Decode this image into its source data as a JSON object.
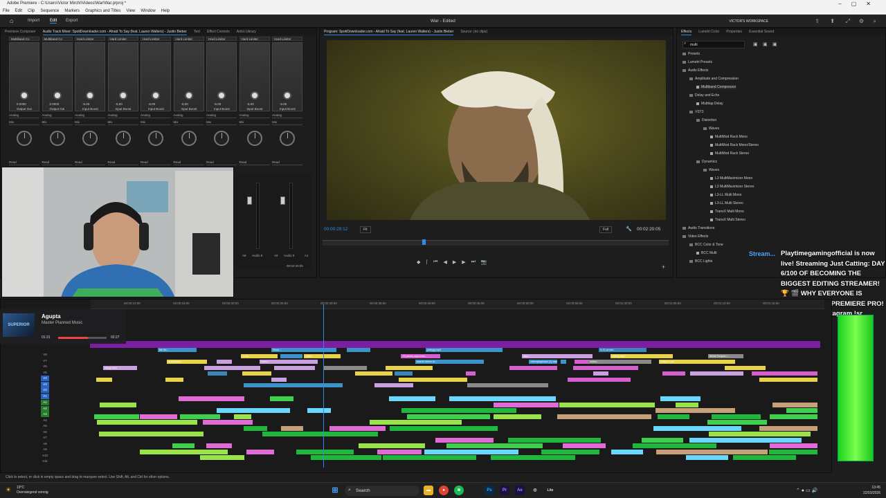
{
  "window": {
    "title": "Adobe Premiere - C:\\Users\\Victor Mirchi\\Videos\\War\\War.prproj *"
  },
  "menu": [
    "File",
    "Edit",
    "Clip",
    "Sequence",
    "Markers",
    "Graphics and Titles",
    "View",
    "Window",
    "Help"
  ],
  "header": {
    "tabs": [
      "Import",
      "Edit",
      "Export"
    ],
    "active_tab": "Edit",
    "doc_title": "War - Edited",
    "workspace": "VICTOR'S WORKSPACE"
  },
  "left_tabs": [
    "Premiere Composer",
    "Audio Track Mixer: SpotiDownloader.com - Afraid To Say (feat. Lauren Walters) - Justin Bieber",
    "Text",
    "Effect Controls",
    "Artist Library"
  ],
  "mixer": {
    "strips": [
      {
        "fx": "Multiband Co",
        "val": "0.0000",
        "sub": "Output Gai",
        "mode": "Mix"
      },
      {
        "fx": "Multiband Co",
        "val": "0.0000",
        "sub": "Output Gai",
        "mode": "Mix"
      },
      {
        "fx": "Hard Limiter",
        "val": "-6.00",
        "sub": "Input Boost",
        "mode": "Mix"
      },
      {
        "fx": "Hard Limiter",
        "val": "-6.00",
        "sub": "Input Boost",
        "mode": "Mix"
      },
      {
        "fx": "Hard Limiter",
        "val": "-6.00",
        "sub": "Input Boost",
        "mode": "Mix"
      },
      {
        "fx": "Hard Limiter",
        "val": "-6.00",
        "sub": "Input Boost",
        "mode": "Mix"
      },
      {
        "fx": "Hard Limiter",
        "val": "-6.00",
        "sub": "Input Boost",
        "mode": "Mix"
      },
      {
        "fx": "Hard Limiter",
        "val": "-6.00",
        "sub": "Input Boost",
        "mode": "Mix"
      },
      {
        "fx": "Hard Limiter",
        "val": "-6.00",
        "sub": "Input Boost",
        "mode": "Mix"
      }
    ],
    "send": "Analog",
    "read": "Read",
    "meter_labels": [
      "A8",
      "Audio 8",
      "A9",
      "Audio 9",
      "A1"
    ],
    "bottom_tc": "00:02:20:05"
  },
  "program": {
    "tab": "Program: SpotiDownloader.com - Afraid To Say (feat. Lauren Walters) - Justin Bieber",
    "source_tab": "Source: (no clips)",
    "timecode": "00:00:29:12",
    "fit": "Fit",
    "quality": "Full",
    "duration": "00:02:20:05"
  },
  "effects": {
    "tabs": [
      "Effects",
      "Lumetri Color",
      "Properties",
      "Essential Sound"
    ],
    "search_value": "multi",
    "tree": [
      {
        "label": "Presets",
        "depth": 0
      },
      {
        "label": "Lumetri Presets",
        "depth": 0
      },
      {
        "label": "Audio Effects",
        "depth": 0
      },
      {
        "label": "Amplitude and Compression",
        "depth": 1
      },
      {
        "label": "Multiband Compressor",
        "depth": 2,
        "file": true,
        "selected": true
      },
      {
        "label": "Delay and Echo",
        "depth": 1
      },
      {
        "label": "Multitap Delay",
        "depth": 2,
        "file": true
      },
      {
        "label": "VST3",
        "depth": 1
      },
      {
        "label": "Distortion",
        "depth": 2
      },
      {
        "label": "Waves",
        "depth": 3
      },
      {
        "label": "MultiMod Rack Mono",
        "depth": 4,
        "file": true
      },
      {
        "label": "MultiMod Rack Mono/Stereo",
        "depth": 4,
        "file": true
      },
      {
        "label": "MultiMod Rack Stereo",
        "depth": 4,
        "file": true
      },
      {
        "label": "Dynamics",
        "depth": 2
      },
      {
        "label": "Waves",
        "depth": 3
      },
      {
        "label": "L3 MultiMaximizer Mono",
        "depth": 4,
        "file": true
      },
      {
        "label": "L3 MultiMaximizer Stereo",
        "depth": 4,
        "file": true
      },
      {
        "label": "L3-LL Multi Mono",
        "depth": 4,
        "file": true
      },
      {
        "label": "L3-LL Multi Stereo",
        "depth": 4,
        "file": true
      },
      {
        "label": "TransX Multi Mono",
        "depth": 4,
        "file": true
      },
      {
        "label": "TransX Multi Stereo",
        "depth": 4,
        "file": true
      },
      {
        "label": "Audio Transitions",
        "depth": 0
      },
      {
        "label": "Video Effects",
        "depth": 0
      },
      {
        "label": "BCC Color & Tone",
        "depth": 1
      },
      {
        "label": "BCC Multi",
        "depth": 2,
        "file": true
      },
      {
        "label": "BCC Lights",
        "depth": 1
      }
    ]
  },
  "stream": {
    "label": "Stream...",
    "chat": "Playtimegamingofficial is now live! Streaming Just Catting: DAY 6/100 OF BECOMING THE BIGGEST EDITING STREAMER! 🏆 🎬 WHY EVERYONE IS SWITCHING TO PREMIERE PRO! 🎬 !discord !instagram !sr !youtube"
  },
  "music": {
    "artist": "Agupta",
    "subtitle": "Master Planned Music",
    "elapsed": "01:31",
    "total": "02:27",
    "cover": "SUPERIOR",
    "progress": 0.62
  },
  "timeline": {
    "ruler": [
      "00:00:10:00",
      "00:00:15:00",
      "00:00:20:00",
      "00:00:25:00",
      "00:00:30:00",
      "00:00:35:00",
      "00:00:40:00",
      "00:00:45:00",
      "00:00:50:00",
      "00:00:55:00",
      "00:01:00:00",
      "00:01:05:00",
      "00:01:10:00",
      "00:01:15:00"
    ],
    "video_tracks": [
      "V8",
      "V7",
      "V6",
      "V5",
      "V4",
      "V3",
      "V2",
      "V1"
    ],
    "audio_tracks": [
      "A1",
      "A2",
      "A3",
      "A4",
      "A5",
      "A6",
      "A7",
      "A8",
      "A9",
      "A10",
      "A11"
    ],
    "clip_labels": [
      "fire ita...",
      "Rock...",
      "ymkyg.mp4",
      "9-11-ameri...",
      "9-11...",
      "video.",
      "10-years-ago-prev...",
      "sfsc..",
      "videoplayb...",
      "Metal Sequen...",
      "videoplayb...",
      "Video..",
      "martin luther ki...",
      "videoplayback (1).mp4",
      "video...",
      "xmkyn.mp4",
      "mkyg.mp4"
    ]
  },
  "status": "Click to select, or click in empty space and drag to marquee select. Use Shift, Alt, and Ctrl for other options.",
  "taskbar": {
    "temp": "19°C",
    "weather": "Overwiegend sonnig",
    "search": "Search",
    "time": "13:45",
    "date": "22/03/2026"
  }
}
